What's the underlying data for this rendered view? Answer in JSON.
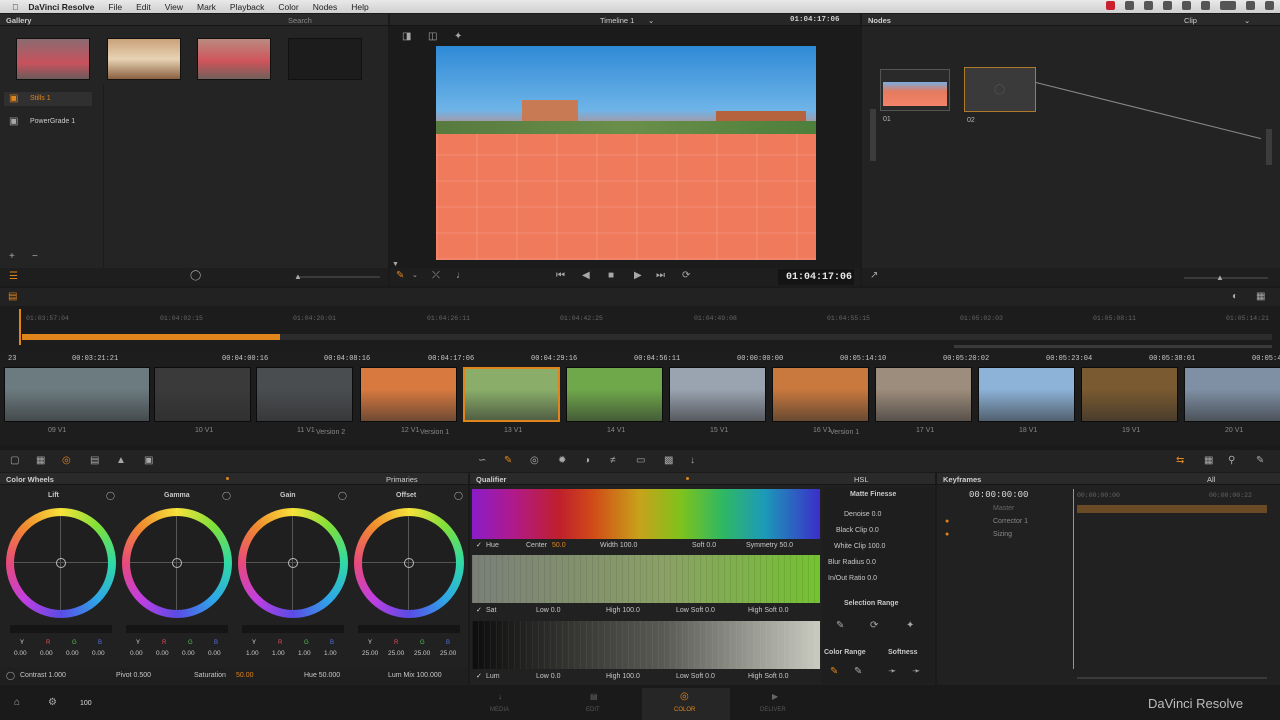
{
  "menubar": {
    "app": "DaVinci Resolve",
    "items": [
      "File",
      "Edit",
      "View",
      "Mark",
      "Playback",
      "Color",
      "Nodes",
      "Help"
    ]
  },
  "gallery": {
    "title": "Gallery",
    "search_placeholder": "Search",
    "albums": [
      "Stills 1",
      "PowerGrade 1"
    ]
  },
  "viewer": {
    "timeline_name": "Timeline 1",
    "timecode_top": "01:04:17:06",
    "timecode": "01:04:17:06"
  },
  "nodes": {
    "title": "Nodes",
    "mode": "Clip",
    "node1_label": "01",
    "node2_label": "02"
  },
  "ruler": {
    "ticks": [
      "01:03:57:04",
      "01:04:02:15",
      "01:04:20:01",
      "01:04:26:11",
      "01:04:42:25",
      "01:04:49:08",
      "01:04:55:15",
      "01:05:02:03",
      "01:05:08:11",
      "01:05:14:21"
    ]
  },
  "clips": {
    "first_label": "23",
    "timecodes": [
      "00:03:21:21",
      "00:04:00:16",
      "00:04:08:16",
      "00:04:17:06",
      "00:04:29:16",
      "00:04:56:11",
      "00:00:00:00",
      "00:05:14:10",
      "00:05:20:02",
      "00:05:23:04",
      "00:05:38:01",
      "00:05:49:11"
    ],
    "labels": [
      "09 V1",
      "10 V1",
      "11 V1",
      "12 V1",
      "13 V1",
      "14 V1",
      "15 V1",
      "16 V1",
      "17 V1",
      "18 V1",
      "19 V1",
      "20 V1"
    ],
    "versions": [
      "Version 2",
      "Version 1",
      "Version 1"
    ],
    "colors": [
      "#6c7b80",
      "#3a3a3a",
      "#4a4d50",
      "#d87a40",
      "#8aae6a",
      "#6fa84b",
      "#9aa3b0",
      "#c9793e",
      "#9d8d7c",
      "#8db3d8",
      "#7a5a30",
      "#7f90a4"
    ]
  },
  "color_wheels": {
    "title": "Color Wheels",
    "mode": "Primaries",
    "wheels": [
      {
        "name": "Lift",
        "values": [
          "0.00",
          "0.00",
          "0.00",
          "0.00"
        ]
      },
      {
        "name": "Gamma",
        "values": [
          "0.00",
          "0.00",
          "0.00",
          "0.00"
        ]
      },
      {
        "name": "Gain",
        "values": [
          "1.00",
          "1.00",
          "1.00",
          "1.00"
        ]
      },
      {
        "name": "Offset",
        "values": [
          "25.00",
          "25.00",
          "25.00",
          "25.00"
        ]
      }
    ],
    "channel_letters": [
      "Y",
      "R",
      "G",
      "B"
    ],
    "contrast": "Contrast 1.000",
    "pivot": "Pivot 0.500",
    "saturation_label": "Saturation",
    "saturation_value": "50.00",
    "hue": "Hue 50.000",
    "lum_mix": "Lum Mix 100.000"
  },
  "qualifier": {
    "title": "Qualifier",
    "mode": "HSL",
    "hue_row": {
      "name": "Hue",
      "center_label": "Center",
      "center_value": "50.0",
      "width": "Width 100.0",
      "soft": "Soft 0.0",
      "symmetry": "Symmetry 50.0"
    },
    "sat_row": {
      "name": "Sat",
      "low": "Low 0.0",
      "high": "High 100.0",
      "low_soft": "Low Soft 0.0",
      "high_soft": "High Soft 0.0"
    },
    "lum_row": {
      "name": "Lum",
      "low": "Low 0.0",
      "high": "High 100.0",
      "low_soft": "Low Soft 0.0",
      "high_soft": "High Soft 0.0"
    },
    "matte_title": "Matte Finesse",
    "matte": [
      "Denoise 0.0",
      "Black Clip 0.0",
      "White Clip 100.0",
      "Blur Radius 0.0",
      "In/Out Ratio 0.0"
    ],
    "selection_range": "Selection Range",
    "color_range": "Color Range",
    "softness": "Softness"
  },
  "keyframes": {
    "title": "Keyframes",
    "filter": "All",
    "timecode": "00:00:00:00",
    "tc_ruler1": "00:00:00:00",
    "tc_ruler2": "00:00:00:22",
    "tracks": [
      "Master",
      "Corrector 1",
      "Sizing"
    ]
  },
  "bottom": {
    "count": "100",
    "tabs": [
      "MEDIA",
      "EDIT",
      "COLOR",
      "DELIVER"
    ],
    "brand": "DaVinci Resolve"
  }
}
